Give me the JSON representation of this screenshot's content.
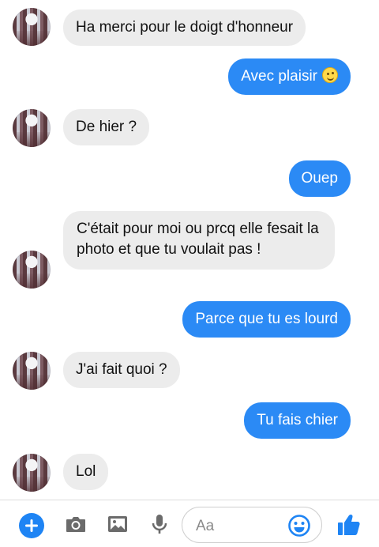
{
  "messages": [
    {
      "side": "in",
      "text": "Ha merci pour le doigt d'honneur"
    },
    {
      "side": "out",
      "text": "Avec plaisir",
      "emoji": "smiley-icon"
    },
    {
      "side": "in",
      "text": "De hier ?"
    },
    {
      "side": "out",
      "text": "Ouep"
    },
    {
      "side": "in",
      "text": "C'était pour moi ou prcq elle fesait la photo et que tu voulait pas !"
    },
    {
      "side": "out",
      "text": "Parce que tu es lourd"
    },
    {
      "side": "in",
      "text": "J'ai fait quoi ?"
    },
    {
      "side": "out",
      "text": "Tu fais chier"
    },
    {
      "side": "in",
      "text": "Lol"
    }
  ],
  "composer": {
    "placeholder": "Aa",
    "icons": [
      "plus-icon",
      "camera-icon",
      "image-icon",
      "microphone-icon",
      "emoji-icon",
      "thumbs-up-icon"
    ]
  },
  "colors": {
    "outgoing_bubble": "#2b8af5",
    "incoming_bubble": "#ececec",
    "accent": "#1e84f4"
  }
}
